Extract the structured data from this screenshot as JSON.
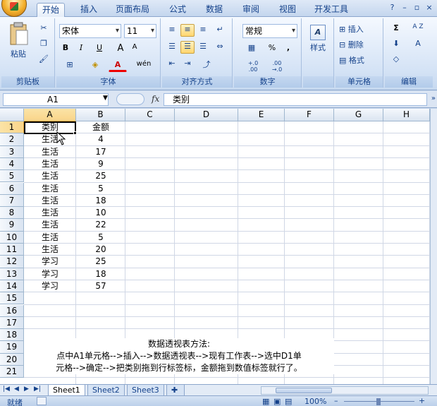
{
  "ribbon_tabs": [
    "开始",
    "插入",
    "页面布局",
    "公式",
    "数据",
    "审阅",
    "视图",
    "开发工具"
  ],
  "window_controls": [
    "?",
    "–",
    "▫",
    "×"
  ],
  "ribbon": {
    "clipboard": {
      "paste": "粘贴",
      "label": "剪贴板"
    },
    "font": {
      "name": "宋体",
      "size": "11",
      "bold": "B",
      "italic": "I",
      "underline": "U",
      "grow": "A",
      "shrink": "A",
      "phonetic": "wén",
      "label": "字体"
    },
    "alignment": {
      "label": "对齐方式"
    },
    "number": {
      "format": "常规",
      "percent": "%",
      "comma": ",",
      "inc": "+.0 .00",
      "dec": ".00 →.0",
      "label": "数字"
    },
    "styles": {
      "style": "样式"
    },
    "cells": {
      "insert": "插入",
      "delete": "删除",
      "format": "格式",
      "label": "单元格"
    },
    "editing": {
      "sigma": "Σ",
      "sort": "A Z",
      "find": "A",
      "label": "编辑"
    }
  },
  "formula_bar": {
    "name_box": "A1",
    "fx": "fx",
    "content": "类别"
  },
  "columns": [
    "A",
    "B",
    "C",
    "D",
    "E",
    "F",
    "G",
    "H"
  ],
  "rows": [
    "1",
    "2",
    "3",
    "4",
    "5",
    "6",
    "7",
    "8",
    "9",
    "10",
    "11",
    "12",
    "13",
    "14",
    "15",
    "16",
    "17",
    "18",
    "19",
    "20",
    "21"
  ],
  "cells": {
    "header": [
      "类别",
      "金额"
    ],
    "data": [
      [
        "生活",
        "4"
      ],
      [
        "生活",
        "17"
      ],
      [
        "生活",
        "9"
      ],
      [
        "生活",
        "25"
      ],
      [
        "生活",
        "5"
      ],
      [
        "生活",
        "18"
      ],
      [
        "生活",
        "10"
      ],
      [
        "生活",
        "22"
      ],
      [
        "生活",
        "5"
      ],
      [
        "生活",
        "20"
      ],
      [
        "学习",
        "25"
      ],
      [
        "学习",
        "18"
      ],
      [
        "学习",
        "57"
      ]
    ]
  },
  "note": {
    "title": "数据透视表方法:",
    "line1": "点中A1单元格-->插入-->数据透视表-->现有工作表-->选中D1单",
    "line2": "元格-->确定-->把类别拖到行标签标，金额拖到数值标签就行了。"
  },
  "sheets": [
    "Sheet1",
    "Sheet2",
    "Sheet3"
  ],
  "status": {
    "mode": "就绪",
    "zoom": "100%",
    "zoom_minus": "–",
    "zoom_plus": "+"
  }
}
